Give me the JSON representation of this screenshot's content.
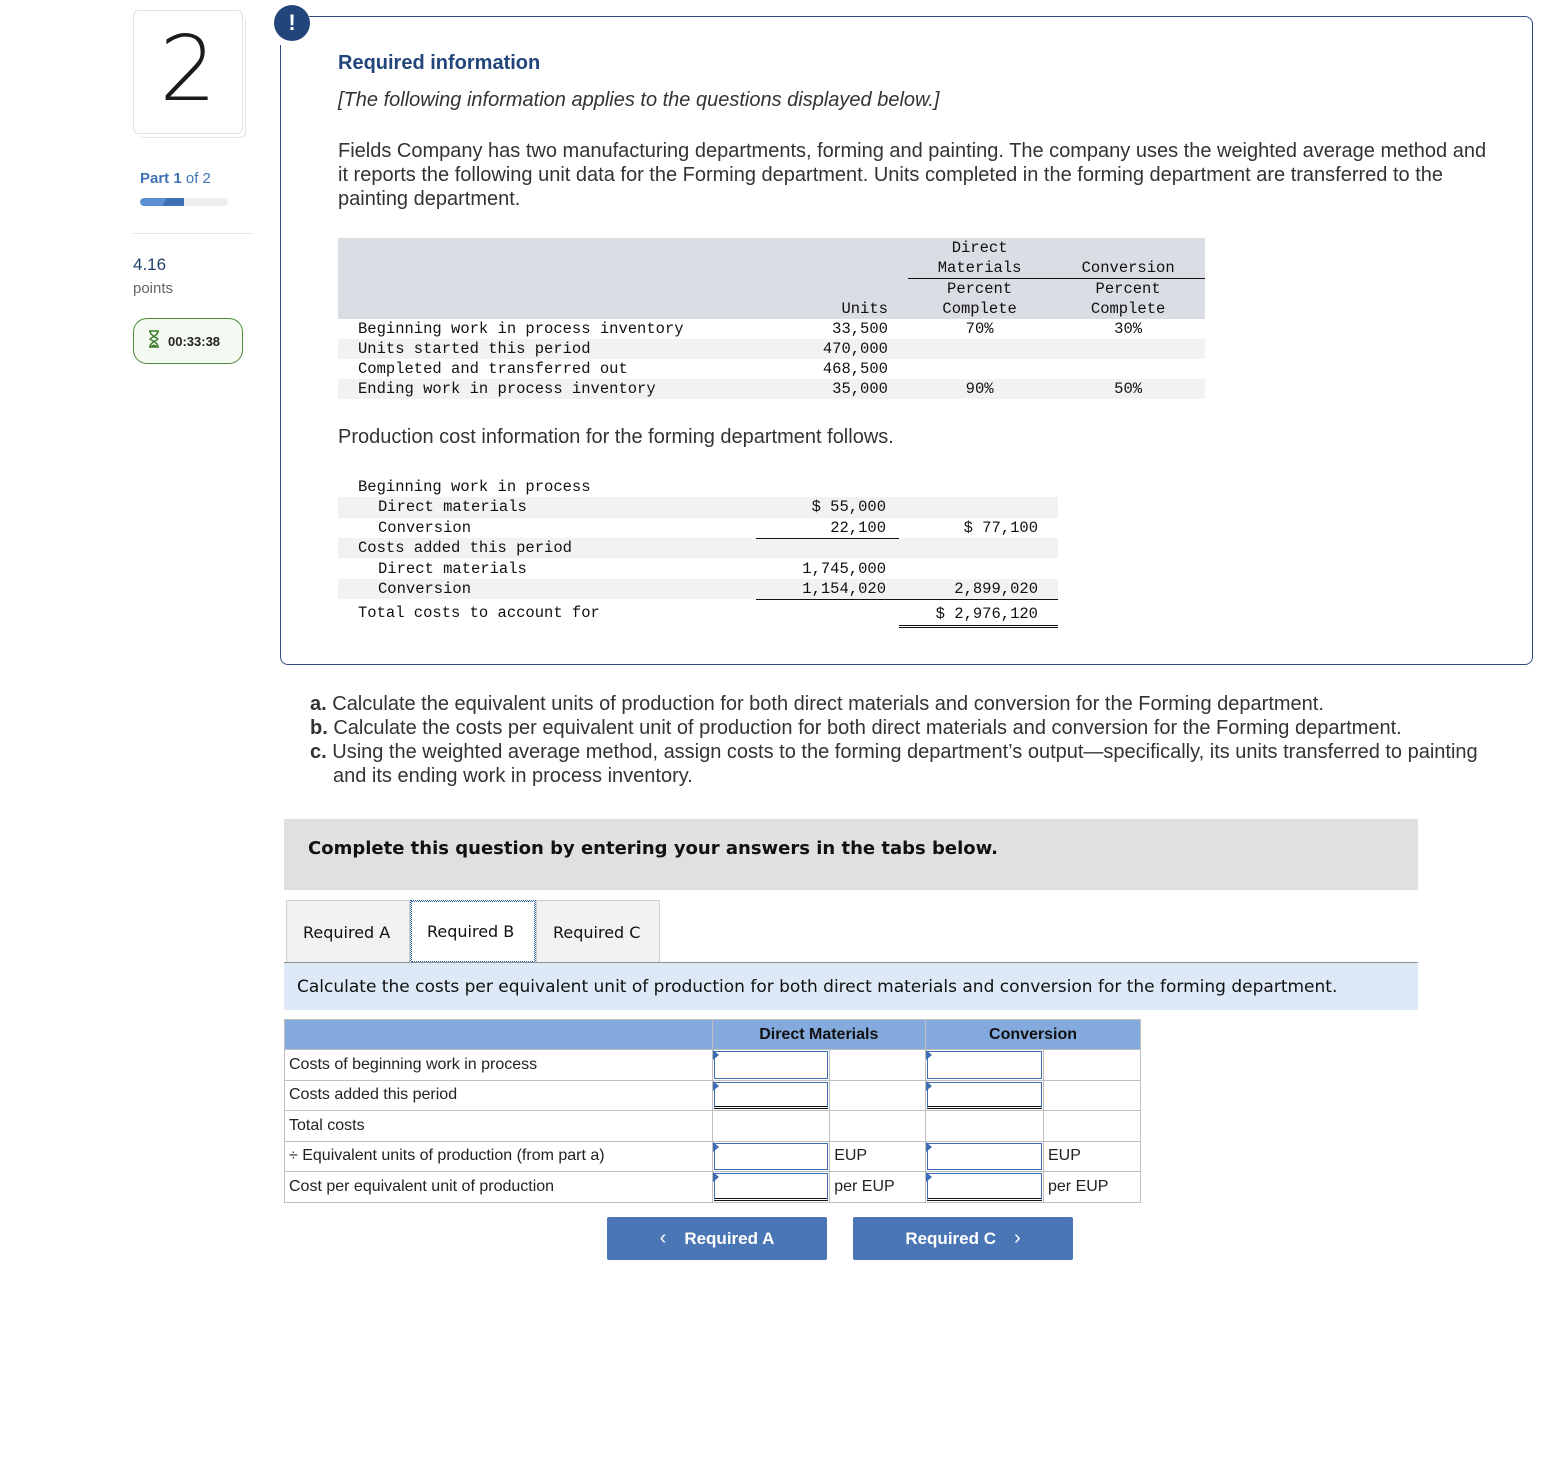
{
  "sidebar": {
    "question_number": "2",
    "part_label_prefix": "Part",
    "part_current": "1",
    "part_suffix": "of 2",
    "part_progress_fraction": 0.5,
    "points_value": "4.16",
    "points_label": "points",
    "timer": "00:33:38",
    "timer_icon": "hourglass-icon"
  },
  "info": {
    "alert_icon_glyph": "!",
    "title": "Required information",
    "subtitle": "[The following information applies to the questions displayed below.]",
    "intro": "Fields Company has two manufacturing departments, forming and painting. The company uses the weighted average method and it reports the following unit data for the Forming department. Units completed in the forming department are transferred to the painting department.",
    "units_table": {
      "headers": {
        "units": "Units",
        "dm_top1": "Direct",
        "dm_top2": "Materials",
        "dm_sub1": "Percent",
        "dm_sub2": "Complete",
        "conv_top": "Conversion",
        "conv_sub1": "Percent",
        "conv_sub2": "Complete"
      },
      "rows": [
        {
          "label": "Beginning work in process inventory",
          "units": "33,500",
          "dm": "70%",
          "conv": "30%"
        },
        {
          "label": "Units started this period",
          "units": "470,000",
          "dm": "",
          "conv": ""
        },
        {
          "label": "Completed and transferred out",
          "units": "468,500",
          "dm": "",
          "conv": ""
        },
        {
          "label": "Ending work in process inventory",
          "units": "35,000",
          "dm": "90%",
          "conv": "50%"
        }
      ]
    },
    "production_intro": "Production cost information for the forming department follows.",
    "cost_table": {
      "rows": [
        {
          "label": "Beginning work in process",
          "mid": "",
          "right": ""
        },
        {
          "label": "Direct materials",
          "mid": "$ 55,000",
          "right": ""
        },
        {
          "label": "Conversion",
          "mid": "22,100",
          "right": "$ 77,100"
        },
        {
          "label": "Costs added this period",
          "mid": "",
          "right": ""
        },
        {
          "label": "Direct materials",
          "mid": "1,745,000",
          "right": ""
        },
        {
          "label": "Conversion",
          "mid": "1,154,020",
          "right": "2,899,020"
        },
        {
          "label": "Total costs to account for",
          "mid": "",
          "right": "$ 2,976,120"
        }
      ]
    }
  },
  "questions": [
    {
      "letter": "a.",
      "text": " Calculate the equivalent units of production for both direct materials and conversion for the Forming department."
    },
    {
      "letter": "b.",
      "text": " Calculate the costs per equivalent unit of production for both direct materials and conversion for the Forming department."
    },
    {
      "letter": "c.",
      "text": " Using the weighted average method, assign costs to the forming department’s output—specifically, its units transferred to painting and its ending work in process inventory."
    }
  ],
  "banner": "Complete this question by entering your answers in the tabs below.",
  "tabs": [
    {
      "label": "Required A",
      "active": false
    },
    {
      "label": "Required B",
      "active": true
    },
    {
      "label": "Required C",
      "active": false
    }
  ],
  "instruction": "Calculate the costs per equivalent unit of production for both direct materials and conversion for the forming department.",
  "answer_grid": {
    "headers": {
      "dm": "Direct Materials",
      "conv": "Conversion"
    },
    "rows": [
      {
        "label": "Costs of beginning work in process",
        "dm_value": "",
        "dm_unit": "",
        "conv_value": "",
        "conv_unit": ""
      },
      {
        "label": "Costs added this period",
        "dm_value": "",
        "dm_unit": "",
        "conv_value": "",
        "conv_unit": ""
      },
      {
        "label": "Total costs",
        "dm_value": "",
        "dm_unit": "",
        "conv_value": "",
        "conv_unit": ""
      },
      {
        "label": "÷ Equivalent units of production (from part a)",
        "dm_value": "",
        "dm_unit": "EUP",
        "conv_value": "",
        "conv_unit": "EUP"
      },
      {
        "label": "Cost per equivalent unit of production",
        "dm_value": "",
        "dm_unit": "per EUP",
        "conv_value": "",
        "conv_unit": "per EUP"
      }
    ]
  },
  "nav": {
    "prev_label": "Required A",
    "prev_icon": "‹",
    "next_label": "Required C",
    "next_icon": "›"
  },
  "colors": {
    "accent_navy": "#22457c",
    "tab_focus": "#2d5fa8",
    "grid_header": "#84a9dc",
    "nav_button": "#4a76b6",
    "timer_border": "#4c8a3a"
  }
}
